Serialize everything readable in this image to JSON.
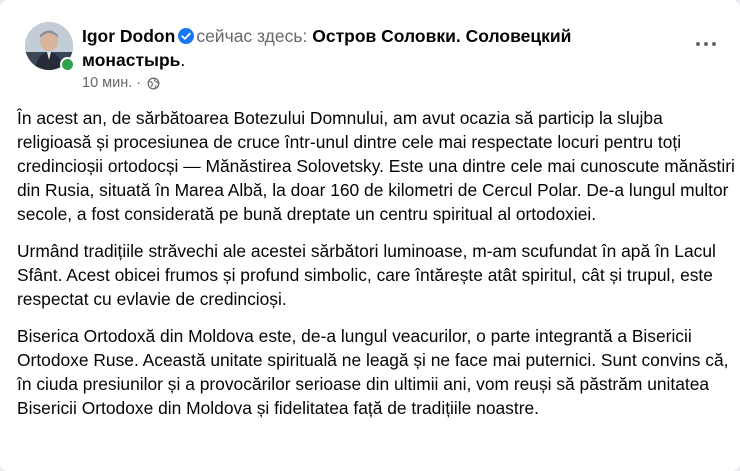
{
  "post": {
    "author": "Igor Dodon",
    "checkin_prefix": "сейчас здесь:",
    "place": "Остров Соловки. Соловецкий монастырь",
    "place_suffix": ".",
    "time": "10 мин.",
    "separator": "·",
    "icons": {
      "verified": "verified-badge-icon",
      "privacy": "globe-icon",
      "menu": "more-options-icon"
    },
    "colors": {
      "verified": "#1877f2",
      "online": "#31a24c",
      "muted": "#65676b"
    },
    "paragraphs": [
      "În acest an, de sărbătoarea Botezului Domnului, am avut ocazia să particip la slujba religioasă și procesiunea de cruce într-unul dintre cele mai respectate locuri pentru toți credincioșii ortodocși — Mănăstirea Solovetsky. Este una dintre cele mai cunoscute mănăstiri din Rusia, situată în Marea Albă, la doar 160 de kilometri de Cercul Polar. De-a lungul multor secole, a fost considerată pe bună dreptate un centru spiritual al ortodoxiei.",
      "Urmând tradițiile străvechi ale acestei sărbători luminoase, m-am scufundat în apă în Lacul Sfânt. Acest obicei frumos și profund simbolic, care întărește atât spiritul, cât și trupul, este respectat cu evlavie de credincioși.",
      "Biserica Ortodoxă din Moldova este, de-a lungul veacurilor, o parte integrantă a Bisericii Ortodoxe Ruse. Această unitate spirituală ne leagă și ne face mai puternici. Sunt convins că, în ciuda presiunilor și a provocărilor serioase din ultimii ani, vom reuși să păstrăm unitatea Bisericii Ortodoxe din Moldova și fidelitatea față de tradițiile noastre."
    ]
  }
}
